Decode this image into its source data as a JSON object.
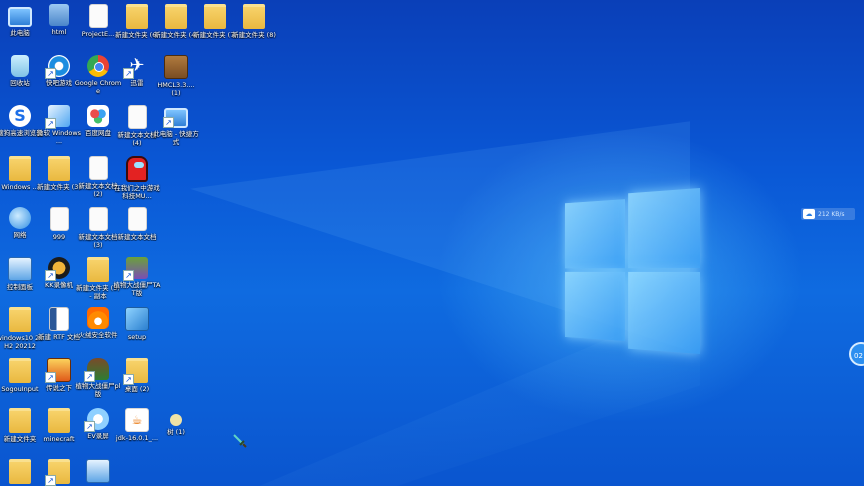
{
  "desktop_icons": [
    {
      "label": "此电脑",
      "icon": "computer-icon"
    },
    {
      "label": "html",
      "icon": "html-folder-icon"
    },
    {
      "label": "ProjectE...",
      "icon": "document-icon"
    },
    {
      "label": "新建文件夹 (6)",
      "icon": "folder-icon"
    },
    {
      "label": "新建文件夹 (4)",
      "icon": "folder-icon"
    },
    {
      "label": "新建文件夹 (7)",
      "icon": "folder-icon"
    },
    {
      "label": "新建文件夹 (8)",
      "icon": "folder-icon"
    },
    {
      "label": "回收站",
      "icon": "recycle-bin-icon"
    },
    {
      "label": "快吧游戏",
      "icon": "kuaiba-game-icon"
    },
    {
      "label": "Google Chrome",
      "icon": "chrome-icon"
    },
    {
      "label": "迅雷",
      "icon": "xunlei-icon"
    },
    {
      "label": "HMCL3.3.... (1)",
      "icon": "minecraft-launcher-icon"
    },
    {
      "label": "搜狗高速浏览器",
      "icon": "sogou-browser-icon"
    },
    {
      "label": "微软 Windows ...",
      "icon": "windows-installer-icon"
    },
    {
      "label": "百度网盘",
      "icon": "baidu-netdisk-icon"
    },
    {
      "label": "新建文本文档 (4)",
      "icon": "text-document-icon"
    },
    {
      "label": "此电脑 - 快捷方式",
      "icon": "computer-shortcut-icon"
    },
    {
      "label": "Windows ...",
      "icon": "folder-icon"
    },
    {
      "label": "新建文件夹 (3)",
      "icon": "folder-icon"
    },
    {
      "label": "新建文本文档 (2)",
      "icon": "text-document-icon"
    },
    {
      "label": "在我们之中游戏科技MU...",
      "icon": "among-us-icon"
    },
    {
      "label": "网络",
      "icon": "network-icon"
    },
    {
      "label": "999",
      "icon": "text-document-icon"
    },
    {
      "label": "新建文本文档 (3)",
      "icon": "text-document-icon"
    },
    {
      "label": "新建文本文档",
      "icon": "text-document-icon"
    },
    {
      "label": "控制面板",
      "icon": "control-panel-icon"
    },
    {
      "label": "KK录像机",
      "icon": "kk-recorder-icon"
    },
    {
      "label": "新建文件夹 (5) - 副本",
      "icon": "folder-icon"
    },
    {
      "label": "植物大战僵尸TAT版",
      "icon": "pvz-icon"
    },
    {
      "label": "windows10 20H2 20212",
      "icon": "folder-icon"
    },
    {
      "label": "新建 RTF 文档",
      "icon": "rtf-document-icon"
    },
    {
      "label": "火绒安全软件",
      "icon": "huorong-icon"
    },
    {
      "label": "setup",
      "icon": "setup-icon"
    },
    {
      "label": "SogouInput",
      "icon": "folder-icon"
    },
    {
      "label": "传说之下",
      "icon": "undertale-icon"
    },
    {
      "label": "植物大战僵尸pl版",
      "icon": "pvz-zombie-icon"
    },
    {
      "label": "桌面 (2)",
      "icon": "folder-icon"
    },
    {
      "label": "新建文件夹",
      "icon": "folder-icon"
    },
    {
      "label": "minecraft",
      "icon": "folder-icon"
    },
    {
      "label": "EV录屏",
      "icon": "ev-recorder-icon"
    },
    {
      "label": "jdk-16.0.1_...",
      "icon": "java-icon"
    },
    {
      "label": "树 (1)",
      "icon": "small-app-icon"
    },
    {
      "label": "",
      "icon": "folder-icon"
    },
    {
      "label": "",
      "icon": "folder-icon"
    },
    {
      "label": "",
      "icon": "control-panel-icon"
    }
  ],
  "net_widget": {
    "speed": "212 KB/s",
    "icon": "cloud-icon"
  },
  "floating_ball": {
    "text": "02"
  },
  "colors": {
    "wallpaper_top": "#0a3fb8",
    "wallpaper_mid": "#0f6be0",
    "logo_glow": "#8cd7ff"
  }
}
